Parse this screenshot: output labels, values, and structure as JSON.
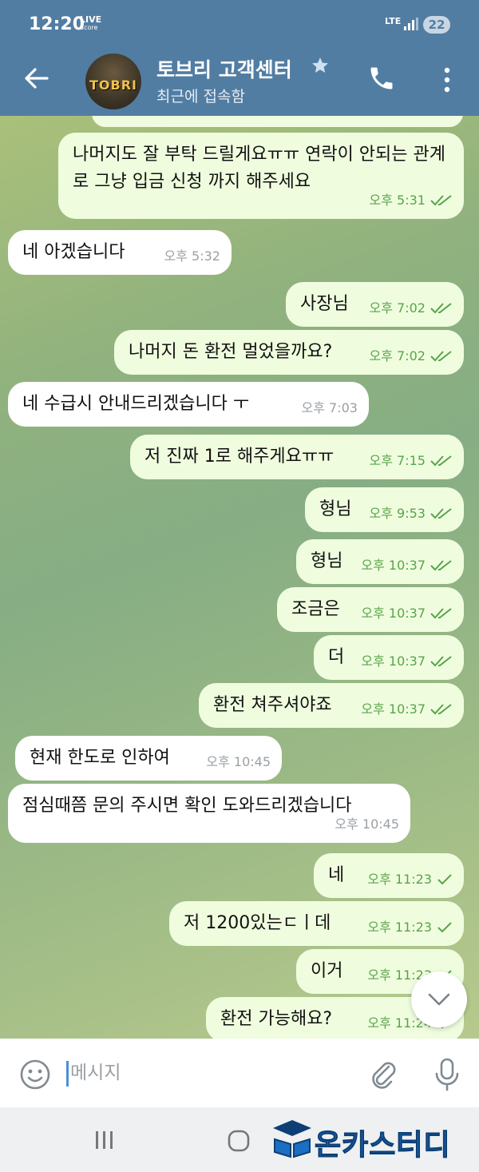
{
  "status_bar": {
    "time": "12:20",
    "live_badge_top": "LIVE",
    "live_badge_bottom": "Score",
    "network": "LTE",
    "battery": "22"
  },
  "header": {
    "back_icon": "arrow-left-icon",
    "avatar_text": "TOBRI",
    "title": "토브리 고객센터",
    "star_icon": "star-icon",
    "subtitle": "최근에 접속함",
    "call_icon": "phone-icon",
    "menu_icon": "kebab-menu-icon"
  },
  "colors": {
    "header_bg": "#527da3",
    "outgoing_bubble": "#effdde",
    "incoming_bubble": "#ffffff",
    "outgoing_meta": "#5aa34c",
    "incoming_meta": "#9aa0a4"
  },
  "messages": [
    {
      "dir": "out",
      "text": "나머지도 잘 부탁 드릴게요ㅠㅠ 연락이 안되는 관계로 그냥 입금 신청 까지 해주세요",
      "time": "오후 5:31",
      "status": "read"
    },
    {
      "dir": "in",
      "text": "네 아겠습니다",
      "time": "오후 5:32"
    },
    {
      "dir": "out",
      "text": "사장님",
      "time": "오후 7:02",
      "status": "read"
    },
    {
      "dir": "out",
      "text": "나머지 돈 환전 멀었을까요?",
      "time": "오후 7:02",
      "status": "read"
    },
    {
      "dir": "in",
      "text": "네 수급시 안내드리겠습니다 ㅜ",
      "time": "오후 7:03"
    },
    {
      "dir": "out",
      "text": "저 진짜 1로 해주게요ㅠㅠ",
      "time": "오후 7:15",
      "status": "read"
    },
    {
      "dir": "out",
      "text": "형님",
      "time": "오후 9:53",
      "status": "read"
    },
    {
      "dir": "out",
      "text": "형님",
      "time": "오후 10:37",
      "status": "read"
    },
    {
      "dir": "out",
      "text": "조금은",
      "time": "오후 10:37",
      "status": "read"
    },
    {
      "dir": "out",
      "text": "더",
      "time": "오후 10:37",
      "status": "read"
    },
    {
      "dir": "out",
      "text": "환전 쳐주셔야죠",
      "time": "오후 10:37",
      "status": "read"
    },
    {
      "dir": "in",
      "text": "현재 한도로 인하여",
      "time": "오후 10:45"
    },
    {
      "dir": "in",
      "text": "점심때쯤 문의 주시면 확인 도와드리겠습니다",
      "time": "오후 10:45"
    },
    {
      "dir": "out",
      "text": "네",
      "time": "오후 11:23",
      "status": "sent"
    },
    {
      "dir": "out",
      "text": "저 1200있는ㄷㅣ데",
      "time": "오후 11:23",
      "status": "sent"
    },
    {
      "dir": "out",
      "text": "이거",
      "time": "오후 11:23",
      "status": "sent"
    },
    {
      "dir": "out",
      "text": "환전 가능해요?",
      "time": "오후 11:24",
      "status": "sent"
    }
  ],
  "scroll_button_icon": "chevron-down-icon",
  "input_bar": {
    "emoji_icon": "emoji-icon",
    "placeholder": "메시지",
    "attach_icon": "paperclip-icon",
    "mic_icon": "microphone-icon"
  },
  "nav_bar": {
    "recents_icon": "recents-icon",
    "home_icon": "home-icon",
    "watermark_text": "온카스터디"
  }
}
